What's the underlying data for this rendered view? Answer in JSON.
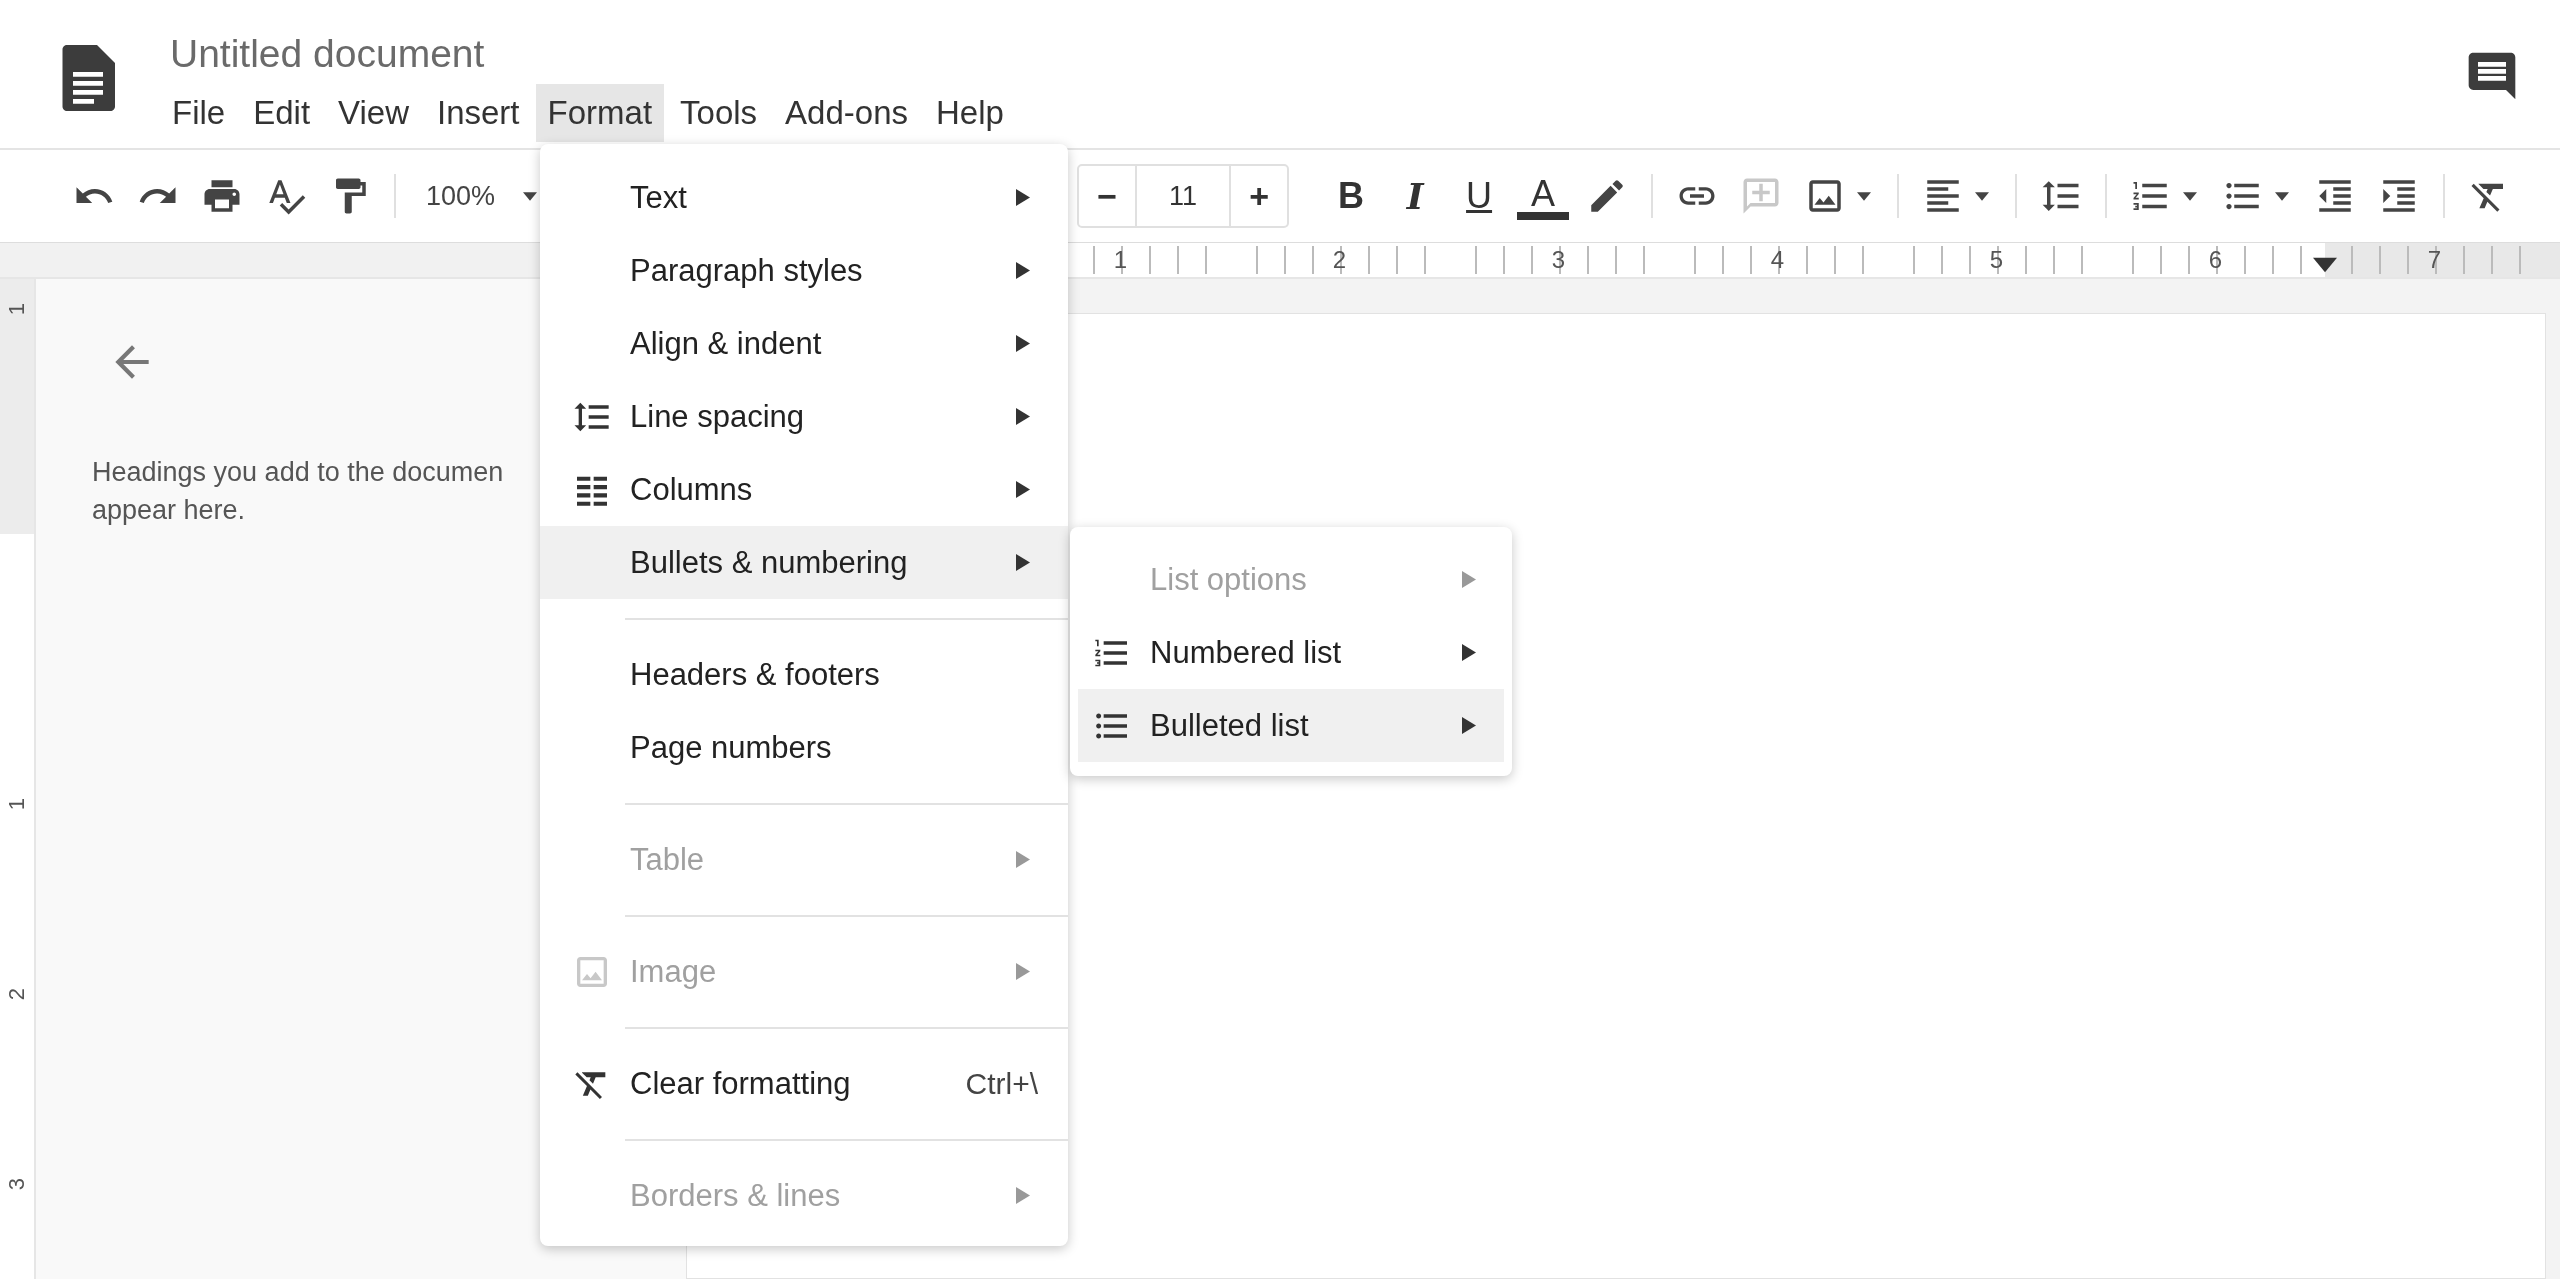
{
  "app": {
    "title": "Untitled document"
  },
  "menu_bar": [
    {
      "label": "File",
      "selected": false
    },
    {
      "label": "Edit",
      "selected": false
    },
    {
      "label": "View",
      "selected": false
    },
    {
      "label": "Insert",
      "selected": false
    },
    {
      "label": "Format",
      "selected": true
    },
    {
      "label": "Tools",
      "selected": false
    },
    {
      "label": "Add-ons",
      "selected": false
    },
    {
      "label": "Help",
      "selected": false
    }
  ],
  "toolbar": {
    "zoom": "100%",
    "font_size": {
      "decrease": "−",
      "value": "11",
      "increase": "+"
    },
    "text_style_buttons": [
      {
        "label": "B",
        "kind": "bold"
      },
      {
        "label": "I",
        "kind": "italic"
      },
      {
        "label": "U",
        "kind": "underline"
      },
      {
        "label": "A",
        "kind": "text-color"
      }
    ]
  },
  "ruler": {
    "horizontal_numbers": [
      "1",
      "2",
      "3",
      "4",
      "5",
      "6",
      "7"
    ],
    "vertical_numbers": [
      "1",
      "1",
      "2",
      "3"
    ]
  },
  "outline": {
    "hint_lines": [
      "Headings you add to the documen",
      "appear here."
    ]
  },
  "format_menu": {
    "items": [
      {
        "kind": "item",
        "label": "Text",
        "submenu": true,
        "disabled": false,
        "selected": false
      },
      {
        "kind": "item",
        "label": "Paragraph styles",
        "submenu": true,
        "disabled": false,
        "selected": false
      },
      {
        "kind": "item",
        "label": "Align & indent",
        "submenu": true,
        "disabled": false,
        "selected": false
      },
      {
        "kind": "item",
        "label": "Line spacing",
        "submenu": true,
        "disabled": false,
        "selected": false
      },
      {
        "kind": "item",
        "label": "Columns",
        "submenu": true,
        "disabled": false,
        "selected": false
      },
      {
        "kind": "item",
        "label": "Bullets & numbering",
        "submenu": true,
        "disabled": false,
        "selected": true
      },
      {
        "kind": "separator"
      },
      {
        "kind": "item",
        "label": "Headers & footers",
        "submenu": false,
        "disabled": false,
        "selected": false
      },
      {
        "kind": "item",
        "label": "Page numbers",
        "submenu": false,
        "disabled": false,
        "selected": false
      },
      {
        "kind": "separator"
      },
      {
        "kind": "item",
        "label": "Table",
        "submenu": true,
        "disabled": true,
        "selected": false
      },
      {
        "kind": "separator"
      },
      {
        "kind": "item",
        "label": "Image",
        "submenu": true,
        "disabled": true,
        "selected": false
      },
      {
        "kind": "separator"
      },
      {
        "kind": "item",
        "label": "Clear formatting",
        "shortcut": "Ctrl+\\",
        "submenu": false,
        "disabled": false,
        "selected": false
      },
      {
        "kind": "separator"
      },
      {
        "kind": "item",
        "label": "Borders & lines",
        "submenu": true,
        "disabled": true,
        "selected": false
      }
    ]
  },
  "submenu": {
    "items": [
      {
        "kind": "item",
        "label": "List options",
        "submenu": true,
        "disabled": true,
        "selected": false
      },
      {
        "kind": "item",
        "label": "Numbered list",
        "submenu": true,
        "disabled": false,
        "selected": false
      },
      {
        "kind": "item",
        "label": "Bulleted list",
        "submenu": true,
        "disabled": false,
        "selected": true
      }
    ]
  }
}
